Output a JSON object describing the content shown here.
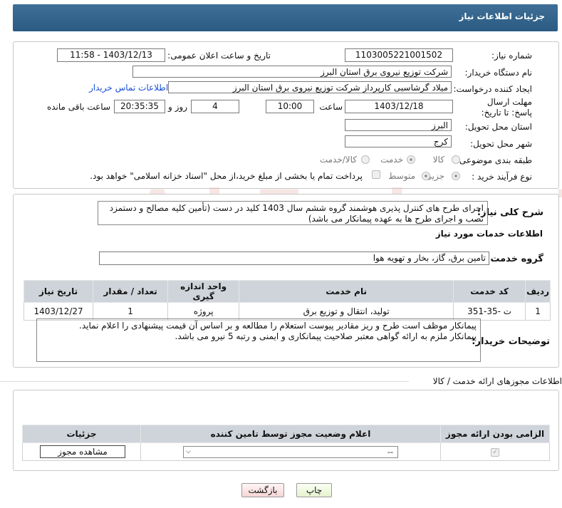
{
  "header": {
    "title": "جزئیات اطلاعات نیاز"
  },
  "form": {
    "need_number_label": "شماره نیاز:",
    "need_number": "1103005221001502",
    "announce_label": "تاریخ و ساعت اعلان عمومی:",
    "announce_value": "1403/12/13 - 11:58",
    "buyer_label": "نام دستگاه خریدار:",
    "buyer_value": "شرکت توزیع نیروی برق استان البرز",
    "creator_label": "ایجاد کننده درخواست:",
    "creator_value": "میلاد گرشاسبی کارپرداز شرکت توزیع نیروی برق استان البرز",
    "contact_link": "اطلاعات تماس خریدار",
    "deadline_label": "مهلت ارسال پاسخ: تا تاریخ:",
    "deadline_date": "1403/12/18",
    "time_label": "ساعت",
    "deadline_time": "10:00",
    "days_value": "4",
    "days_label": "روز و",
    "remaining_time": "20:35:35",
    "remaining_label": "ساعت باقی مانده",
    "province_label": "استان محل تحویل:",
    "province_value": "البرز",
    "city_label": "شهر محل تحویل:",
    "city_value": "کرج",
    "category_label": "طبقه بندی موضوعی:",
    "category_options": [
      "کالا",
      "خدمت",
      "کالا/خدمت"
    ],
    "category_selected": "خدمت",
    "process_label": "نوع فرآیند خرید :",
    "process_options": [
      "جزیی",
      "متوسط"
    ],
    "process_selected": "جزیی",
    "payment_note": "پرداخت تمام یا بخشی از مبلغ خرید،از محل \"اسناد خزانه اسلامی\" خواهد بود."
  },
  "description": {
    "label": "شرح کلی نیاز:",
    "text": "اجرای طرح های کنترل پذیری هوشمند گروه ششم سال 1403 کلید در دست (تأمین کلیه مصالح و دستمزد نصب و اجرای طرح ها به عهده پیمانکار می باشد)"
  },
  "services": {
    "section_title": "اطلاعات خدمات مورد نیاز",
    "group_label": "گروه خدمت:",
    "group_value": "تامین برق، گاز، بخار و تهویه هوا",
    "columns": [
      "ردیف",
      "کد خدمت",
      "نام خدمت",
      "واحد اندازه گیری",
      "تعداد / مقدار",
      "تاریخ نیاز"
    ],
    "rows": [
      [
        "1",
        "ت -35-351",
        "تولید، انتقال و توزیع برق",
        "پروژه",
        "1",
        "1403/12/27"
      ]
    ]
  },
  "buyer_notes": {
    "label": "توضیحات خریدار:",
    "line1": "پیمانکار موظف است طرح و ریز مقادیر پیوست استعلام را مطالعه و بر اساس آن قیمت پیشنهادی را اعلام نماید.",
    "line2": "پیمانکار ملزم به ارائه گواهی معتبر صلاحیت پیمانکاری و ایمنی و رتبه 5 نیرو می باشد."
  },
  "permits": {
    "section_title": "اطلاعات مجوزهای ارائه خدمت / کالا",
    "columns": [
      "الزامی بودن ارائه مجوز",
      "اعلام وضعیت مجوز توسط تامین کننده",
      "جزئیات"
    ],
    "select_value": "--",
    "view_button": "مشاهده مجوز"
  },
  "buttons": {
    "print": "چاپ",
    "back": "بازگشت"
  },
  "watermark": "AriaTender.neT"
}
